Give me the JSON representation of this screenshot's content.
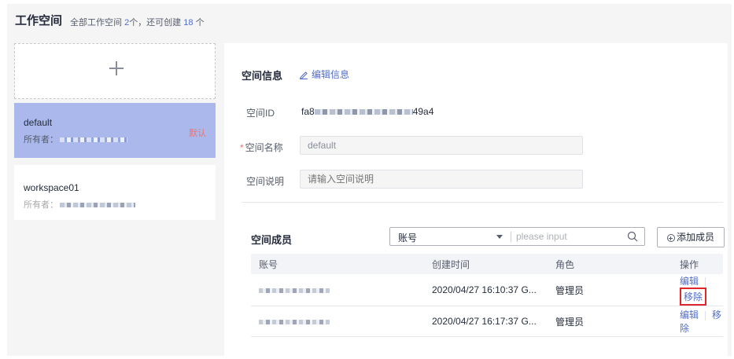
{
  "header": {
    "title": "工作空间",
    "summary_prefix": "全部工作空间",
    "total": "2",
    "summary_mid": "个，还可创建",
    "remaining": "18",
    "summary_suffix": "个"
  },
  "workspaces": [
    {
      "name": "default",
      "owner_label": "所有者：",
      "badge": "默认",
      "selected": true
    },
    {
      "name": "workspace01",
      "owner_label": "所有者：",
      "badge": "",
      "selected": false
    }
  ],
  "info": {
    "title": "空间信息",
    "edit_label": "编辑信息",
    "id_label": "空间ID",
    "id_prefix": "fa8",
    "id_suffix": "49a4",
    "required_mark": "*",
    "name_label": "空间名称",
    "name_value": "default",
    "desc_label": "空间说明",
    "desc_placeholder": "请输入空间说明"
  },
  "members": {
    "title": "空间成员",
    "filter_selected": "账号",
    "search_placeholder": "please input",
    "add_label": "添加成员",
    "columns": [
      "账号",
      "创建时间",
      "角色",
      "操作"
    ],
    "rows": [
      {
        "created": "2020/04/27 16:10:37 G...",
        "role": "管理员",
        "edit": "编辑",
        "remove": "移除"
      },
      {
        "created": "2020/04/27 16:17:37 G...",
        "role": "管理员",
        "edit": "编辑",
        "remove": "移除"
      }
    ]
  },
  "colors": {
    "accent": "#526ecc",
    "selected_card": "#aab8ec",
    "badge": "#f66f6a",
    "highlight_border": "#e0252b"
  }
}
